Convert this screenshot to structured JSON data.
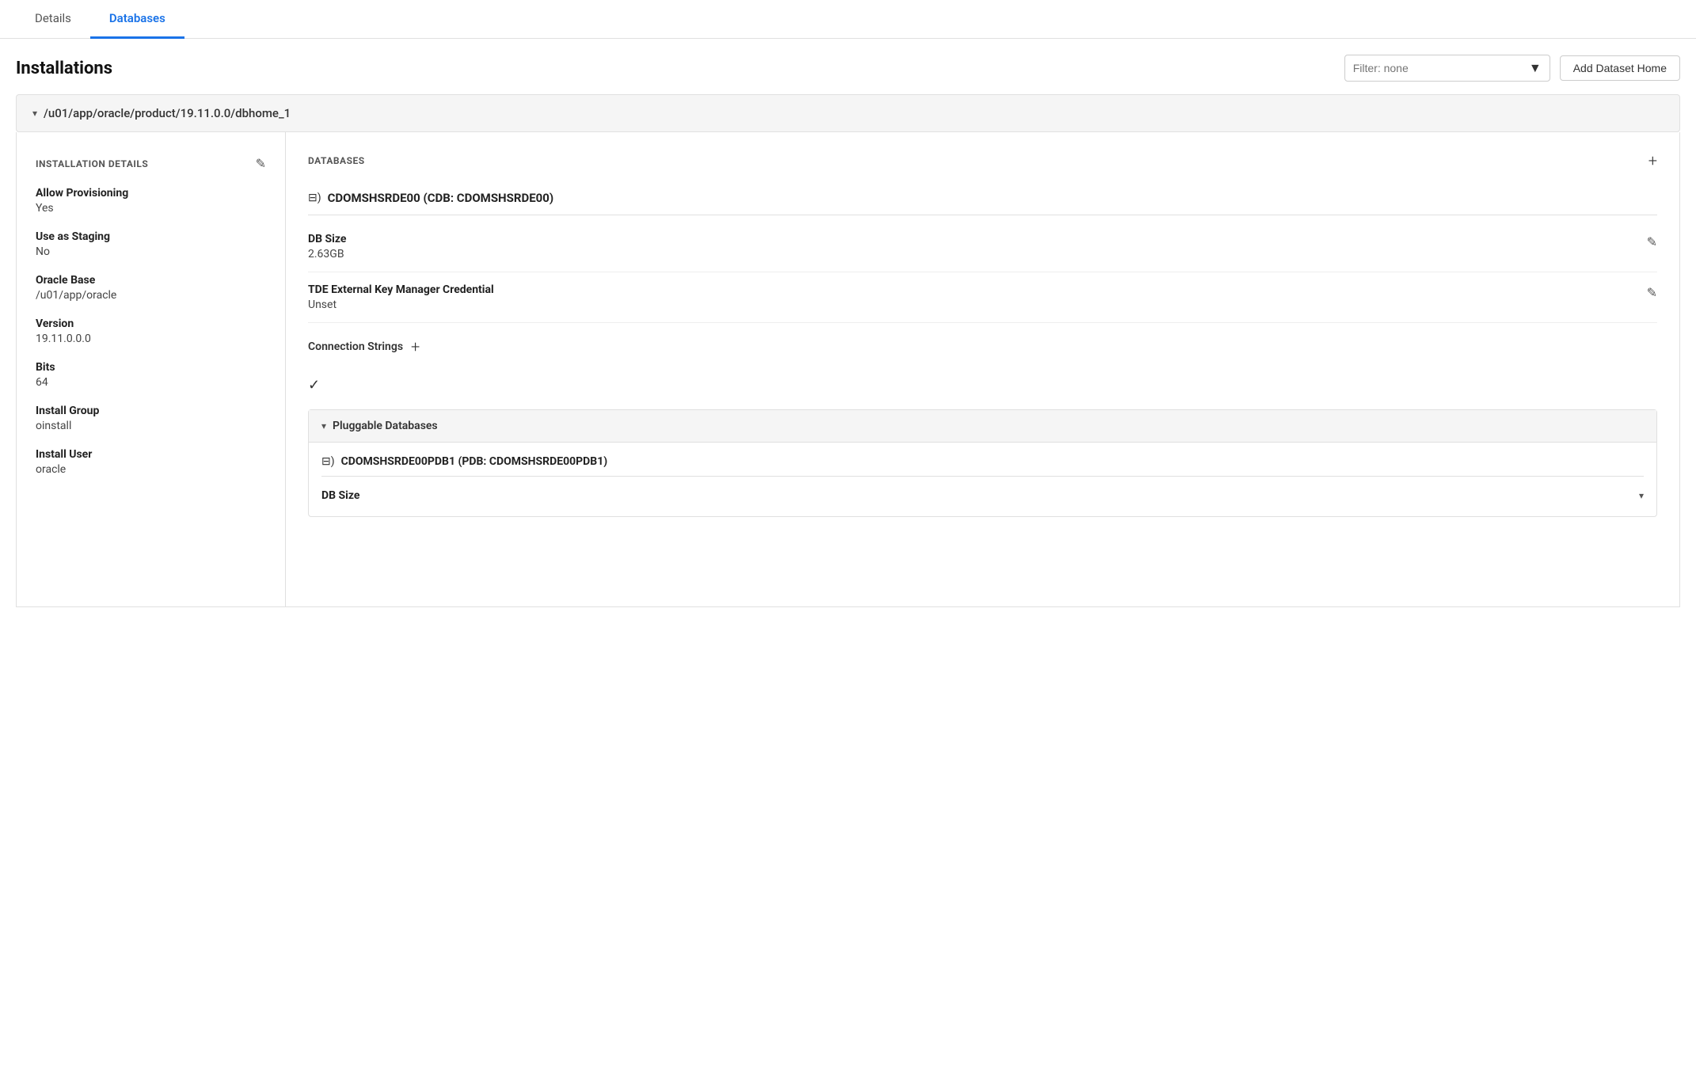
{
  "tabs": [
    {
      "id": "details",
      "label": "Details",
      "active": false
    },
    {
      "id": "databases",
      "label": "Databases",
      "active": true
    }
  ],
  "header": {
    "title": "Installations",
    "filter_placeholder": "Filter: none",
    "add_button_label": "Add Dataset Home"
  },
  "path": {
    "label": "/u01/app/oracle/product/19.11.0.0/dbhome_1"
  },
  "installation_details": {
    "section_title": "INSTALLATION DETAILS",
    "fields": [
      {
        "label": "Allow Provisioning",
        "value": "Yes"
      },
      {
        "label": "Use as Staging",
        "value": "No"
      },
      {
        "label": "Oracle Base",
        "value": "/u01/app/oracle"
      },
      {
        "label": "Version",
        "value": "19.11.0.0.0"
      },
      {
        "label": "Bits",
        "value": "64"
      },
      {
        "label": "Install Group",
        "value": "oinstall"
      },
      {
        "label": "Install User",
        "value": "oracle"
      }
    ]
  },
  "databases": {
    "section_title": "DATABASES",
    "db_name": "CDOMSHSRDE00 (CDB: CDOMSHSRDE00)",
    "db_stream_icon": "&#x29C9;",
    "details": [
      {
        "label": "DB Size",
        "value": "2.63GB"
      },
      {
        "label": "TDE External Key Manager Credential",
        "value": "Unset"
      }
    ],
    "connection_strings_label": "Connection Strings",
    "pluggable": {
      "title": "Pluggable Databases",
      "pdb_name": "CDOMSHSRDE00PDB1 (PDB: CDOMSHSRDE00PDB1)",
      "pdb_details": [
        {
          "label": "DB Size",
          "value": ""
        }
      ]
    }
  },
  "icons": {
    "chevron_down": "▾",
    "chevron_right": "▸",
    "edit": "✎",
    "plus": "+",
    "check": "✓",
    "filter": "▼",
    "stream": "⊟"
  }
}
